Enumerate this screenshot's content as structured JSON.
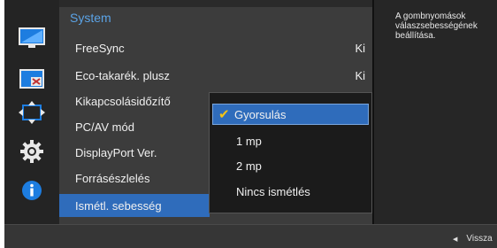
{
  "menu": {
    "title": "System",
    "items": [
      {
        "label": "FreeSync",
        "value": "Ki"
      },
      {
        "label": "Eco-takarék. plusz",
        "value": "Ki"
      },
      {
        "label": "Kikapcsolásidőzítő",
        "value": ""
      },
      {
        "label": "PC/AV mód",
        "value": ""
      },
      {
        "label": "DisplayPort Ver.",
        "value": ""
      },
      {
        "label": "Forrásészlelés",
        "value": ""
      },
      {
        "label": "Ismétl. sebesség",
        "value": ""
      }
    ]
  },
  "dropdown": {
    "options": [
      "Gyorsulás",
      "1 mp",
      "2 mp",
      "Nincs ismétlés"
    ],
    "selected": "Gyorsulás"
  },
  "help": {
    "text": "A gombnyomások válaszsebességének beállítása."
  },
  "footer": {
    "back_label": "Vissza"
  },
  "icons": [
    "monitor-icon",
    "picture-size-icon",
    "position-arrows-icon",
    "settings-gear-icon",
    "info-icon"
  ],
  "colors": {
    "accent": "#2f6cbb",
    "title": "#5ba3e6",
    "check": "#f2c318",
    "background": "#2a2a2a"
  }
}
